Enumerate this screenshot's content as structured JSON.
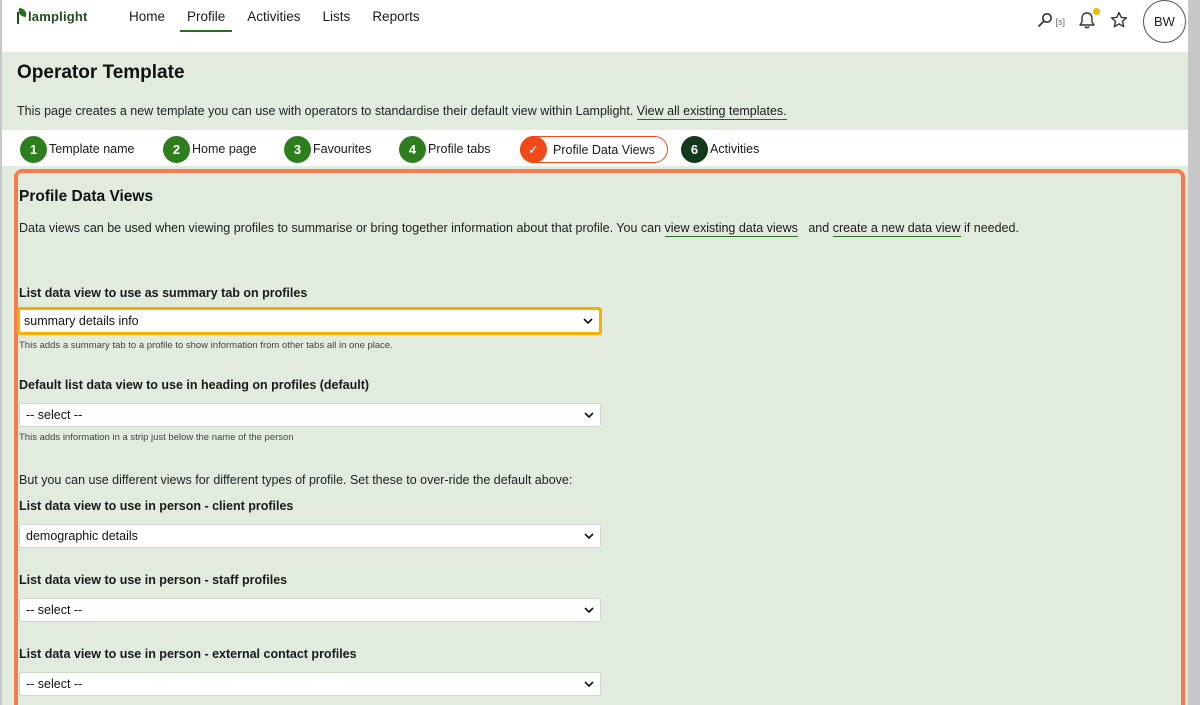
{
  "app": {
    "logo_text": "lamplight"
  },
  "nav": {
    "items": [
      {
        "label": "Home"
      },
      {
        "label": "Profile"
      },
      {
        "label": "Activities"
      },
      {
        "label": "Lists"
      },
      {
        "label": "Reports"
      }
    ],
    "active": "Profile"
  },
  "tools": {
    "search_shortcut": "[s]",
    "avatar_initials": "BW",
    "notification_dot_color": "#f5b800"
  },
  "header": {
    "title": "Operator Template",
    "intro_text": "This page creates a new template you can use with operators to standardise their default view within Lamplight.",
    "intro_link": "View all existing templates."
  },
  "steps": [
    {
      "number": "1",
      "label": "Template name",
      "state": "done"
    },
    {
      "number": "2",
      "label": "Home page",
      "state": "done"
    },
    {
      "number": "3",
      "label": "Favourites",
      "state": "done"
    },
    {
      "number": "4",
      "label": "Profile tabs",
      "state": "done"
    },
    {
      "number": "✓",
      "label": "Profile Data Views",
      "state": "current"
    },
    {
      "number": "6",
      "label": "Activities",
      "state": "pending"
    }
  ],
  "panel": {
    "title": "Profile Data Views",
    "desc_before": "Data views can be used when viewing profiles to summarise or bring together information about that profile. You can",
    "link_existing": "view existing data views",
    "desc_and": "and",
    "link_create": "create a new data view",
    "desc_after": "if needed.",
    "summary": {
      "label": "List data view to use as summary tab on profiles",
      "value": "summary details info",
      "help": "This adds a summary tab to a profile to show information from other tabs all in one place."
    },
    "heading_default": {
      "label": "Default list data view to use in heading on profiles (default)",
      "value": "-- select --",
      "help": "This adds information in a strip just below the name of the person"
    },
    "override_note": "But you can use different views for different types of profile. Set these to over-ride the default above:",
    "client": {
      "label": "List data view to use in person - client profiles",
      "value": "demographic details"
    },
    "staff": {
      "label": "List data view to use in person - staff profiles",
      "value": "-- select --"
    },
    "external": {
      "label": "List data view to use in person - external contact profiles",
      "value": "-- select --"
    }
  },
  "colors": {
    "brand_green": "#2e7d1f",
    "accent_orange": "#f04a1a",
    "focus_yellow": "#f5b000",
    "panel_border": "#f47c50"
  }
}
